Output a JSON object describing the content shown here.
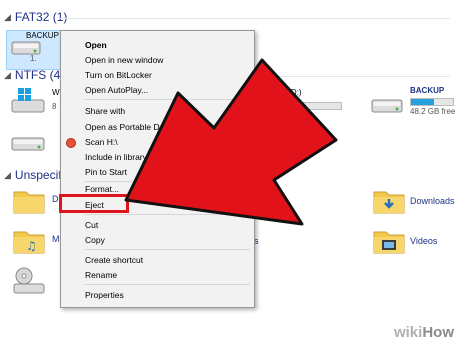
{
  "sections": {
    "fat32": "FAT32 (1)",
    "ntfs": "NTFS (4)",
    "unspecified": "Unspecif"
  },
  "drives": {
    "backup_h_label": "BACKUP (H",
    "backup_h_sub": "1.",
    "ments_d_label": "MENTS (D:)",
    "backup_right_label": "BACKUP",
    "backup_right_sub": "48.2 GB free",
    "ntfs_left_letter": "W",
    "ntfs_left_sub": "8",
    "backup_right_usage_fraction": 0.55
  },
  "folders": {
    "downloads": "Downloads",
    "videos": "Videos",
    "res_partial": "res",
    "d_partial": "D",
    "m_partial": "M"
  },
  "context_menu": {
    "items": [
      "Open",
      "Open in new window",
      "Turn on BitLocker",
      "Open AutoPlay...",
      "Share with",
      "Open as Portable Device",
      "Scan H:\\",
      "Include in library",
      "Pin to Start",
      "Format...",
      "Eject",
      "Cut",
      "Copy",
      "Create shortcut",
      "Rename",
      "Properties"
    ]
  },
  "colors": {
    "highlight_box": "#e0141b",
    "arrow_fill": "#e2121a",
    "selection": "#cde8ff",
    "section_text": "#1e3287"
  },
  "watermark": {
    "wiki": "wiki",
    "how": "How"
  }
}
